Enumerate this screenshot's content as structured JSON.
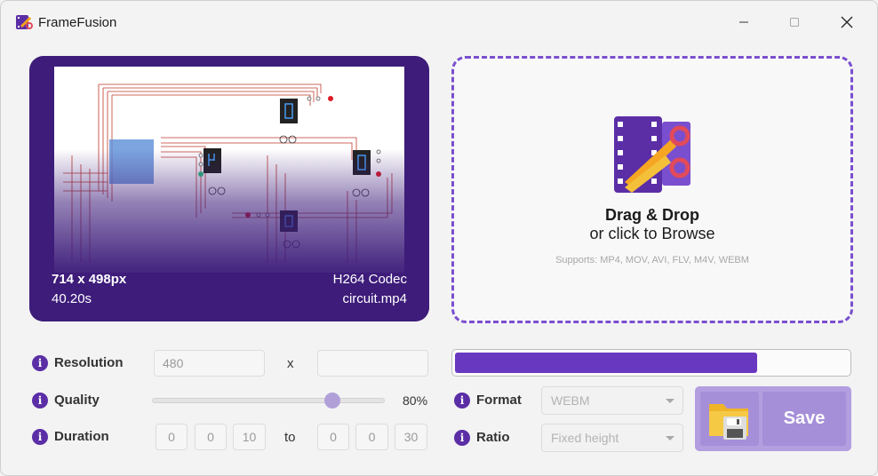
{
  "window": {
    "title": "FrameFusion"
  },
  "preview": {
    "resolution": "714 x 498px",
    "duration": "40.20s",
    "codec": "H264 Codec",
    "filename": "circuit.mp4"
  },
  "dropzone": {
    "title": "Drag & Drop",
    "subtitle": "or click to Browse",
    "formats": "Supports: MP4, MOV, AVI, FLV, M4V, WEBM"
  },
  "resolution": {
    "label": "Resolution",
    "width_placeholder": "480",
    "separator": "x",
    "height_value": ""
  },
  "quality": {
    "label": "Quality",
    "value_text": "80%",
    "value_fraction": 0.8
  },
  "duration": {
    "label": "Duration",
    "from": [
      "0",
      "0",
      "10"
    ],
    "separator": "to",
    "to": [
      "0",
      "0",
      "30"
    ]
  },
  "progress": {
    "fraction": 0.77
  },
  "format": {
    "label": "Format",
    "value": "WEBM"
  },
  "ratio": {
    "label": "Ratio",
    "value": "Fixed height"
  },
  "save": {
    "label": "Save"
  },
  "colors": {
    "accent": "#6838c1",
    "preview_bg": "#3d1c7a",
    "info_icon": "#5b2ea6",
    "save_bg": "#b39ee0"
  }
}
